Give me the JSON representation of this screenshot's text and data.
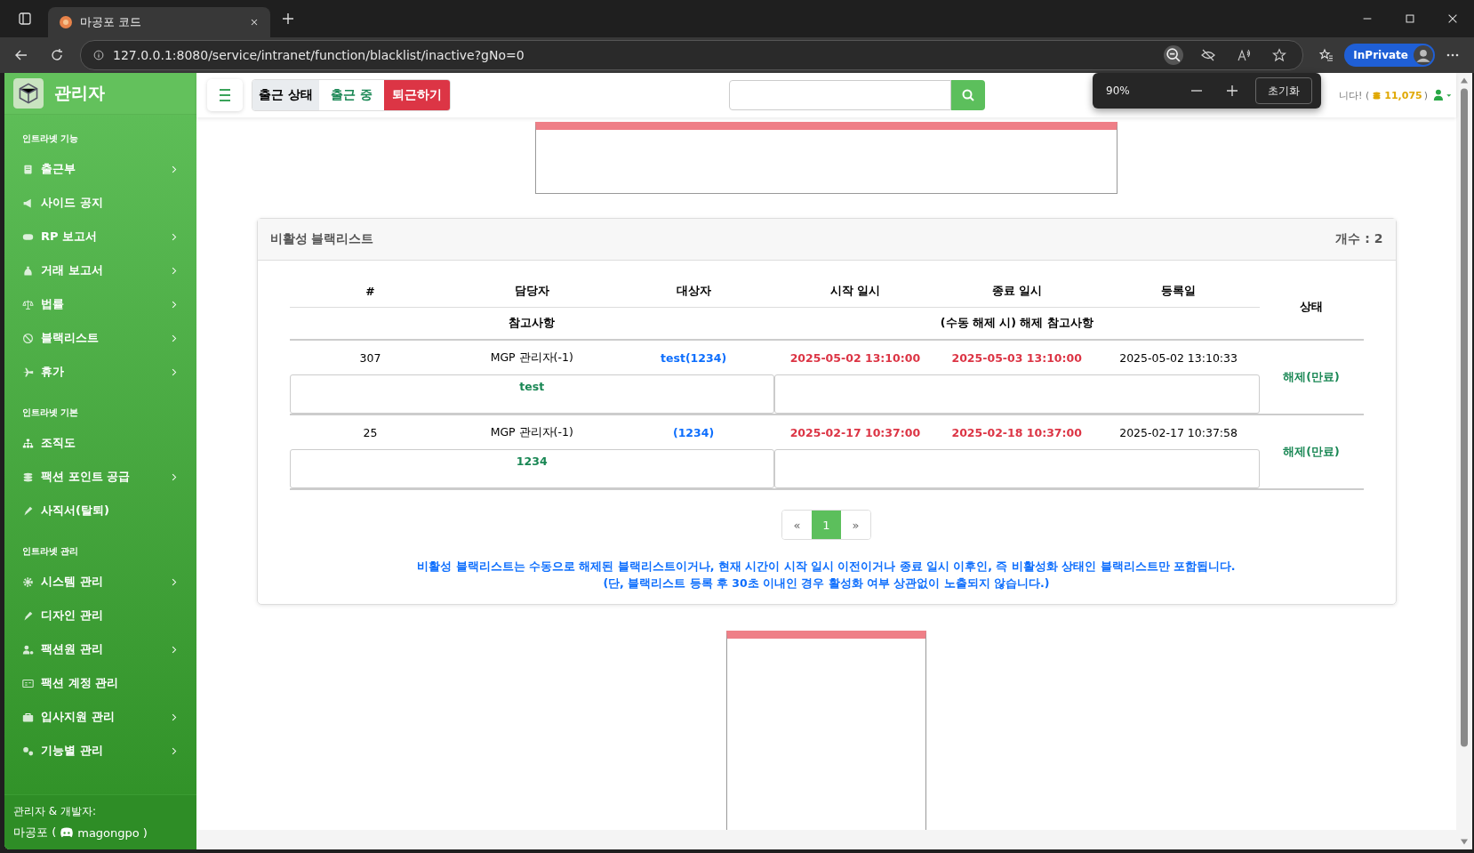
{
  "browser": {
    "tabs": [
      {
        "title": "마공포 코드",
        "selected": true
      }
    ],
    "url": "127.0.0.1:8080/service/intranet/function/blacklist/inactive?gNo=0",
    "profile": "InPrivate",
    "zoom_popup": {
      "level_text": "90%",
      "reset": "초기화"
    }
  },
  "sidebar": {
    "brand": "관리자",
    "sections": [
      {
        "heading": "인트라넷 기능",
        "items": [
          {
            "label": "출근부",
            "submenu": true
          },
          {
            "label": "사이드 공지",
            "submenu": false
          },
          {
            "label": "RP 보고서",
            "submenu": true
          },
          {
            "label": "거래 보고서",
            "submenu": true
          },
          {
            "label": "법률",
            "submenu": true
          },
          {
            "label": "블랙리스트",
            "submenu": true
          },
          {
            "label": "휴가",
            "submenu": true
          }
        ]
      },
      {
        "heading": "인트라넷 기본",
        "items": [
          {
            "label": "조직도",
            "submenu": false
          },
          {
            "label": "팩션 포인트 공급",
            "submenu": true
          },
          {
            "label": "사직서(탈퇴)",
            "submenu": false
          }
        ]
      },
      {
        "heading": "인트라넷 관리",
        "items": [
          {
            "label": "시스템 관리",
            "submenu": true
          },
          {
            "label": "디자인 관리",
            "submenu": false
          },
          {
            "label": "팩션원 관리",
            "submenu": true
          },
          {
            "label": "팩션 계정 관리",
            "submenu": false
          },
          {
            "label": "입사지원 관리",
            "submenu": true
          },
          {
            "label": "기능별 관리",
            "submenu": true
          }
        ]
      }
    ],
    "footer": {
      "caption": "관리자 & 개발자:",
      "name": "마공포 (",
      "handle": "magongpo",
      "close": ")"
    }
  },
  "header": {
    "attendance": {
      "label": "출근 상태",
      "status": "출근 중",
      "button": "퇴근하기"
    },
    "user": {
      "greeting_tail": "니다! (",
      "points": "11,075",
      "close": ")"
    }
  },
  "card": {
    "title": "비활성 블랙리스트",
    "count": "개수 : 2",
    "columns": [
      "#",
      "담당자",
      "대상자",
      "시작 일시",
      "종료 일시",
      "등록일"
    ],
    "note_columns": [
      "참고사항",
      "(수동 해제 시) 해제 참고사항"
    ],
    "status_column": "상태",
    "rows": [
      {
        "id": "307",
        "manager": "MGP 관리자(-1)",
        "target": "test(1234)",
        "start": "2025-05-02 13:10:00",
        "end": "2025-05-03 13:10:00",
        "registered": "2025-05-02 13:10:33",
        "note": "test",
        "status": "해제(만료)"
      },
      {
        "id": "25",
        "manager": "MGP 관리자(-1)",
        "target": "(1234)",
        "start": "2025-02-17 10:37:00",
        "end": "2025-02-18 10:37:00",
        "registered": "2025-02-17 10:37:58",
        "note": "1234",
        "status": "해제(만료)"
      }
    ],
    "pagination": {
      "prev": "«",
      "pages": [
        {
          "label": "1",
          "selected": true
        }
      ],
      "next": "»"
    },
    "notice": [
      "비활성 블랙리스트는 수동으로 해제된 블랙리스트이거나, 현재 시간이 시작 일시 이전이거나 종료 일시 이후인, 즉 비활성화 상태인 블랙리스트만 포함됩니다.",
      "(단, 블랙리스트 등록 후 30초 이내인 경우 활성화 여부 상관없이 노출되지 않습니다.)"
    ]
  }
}
